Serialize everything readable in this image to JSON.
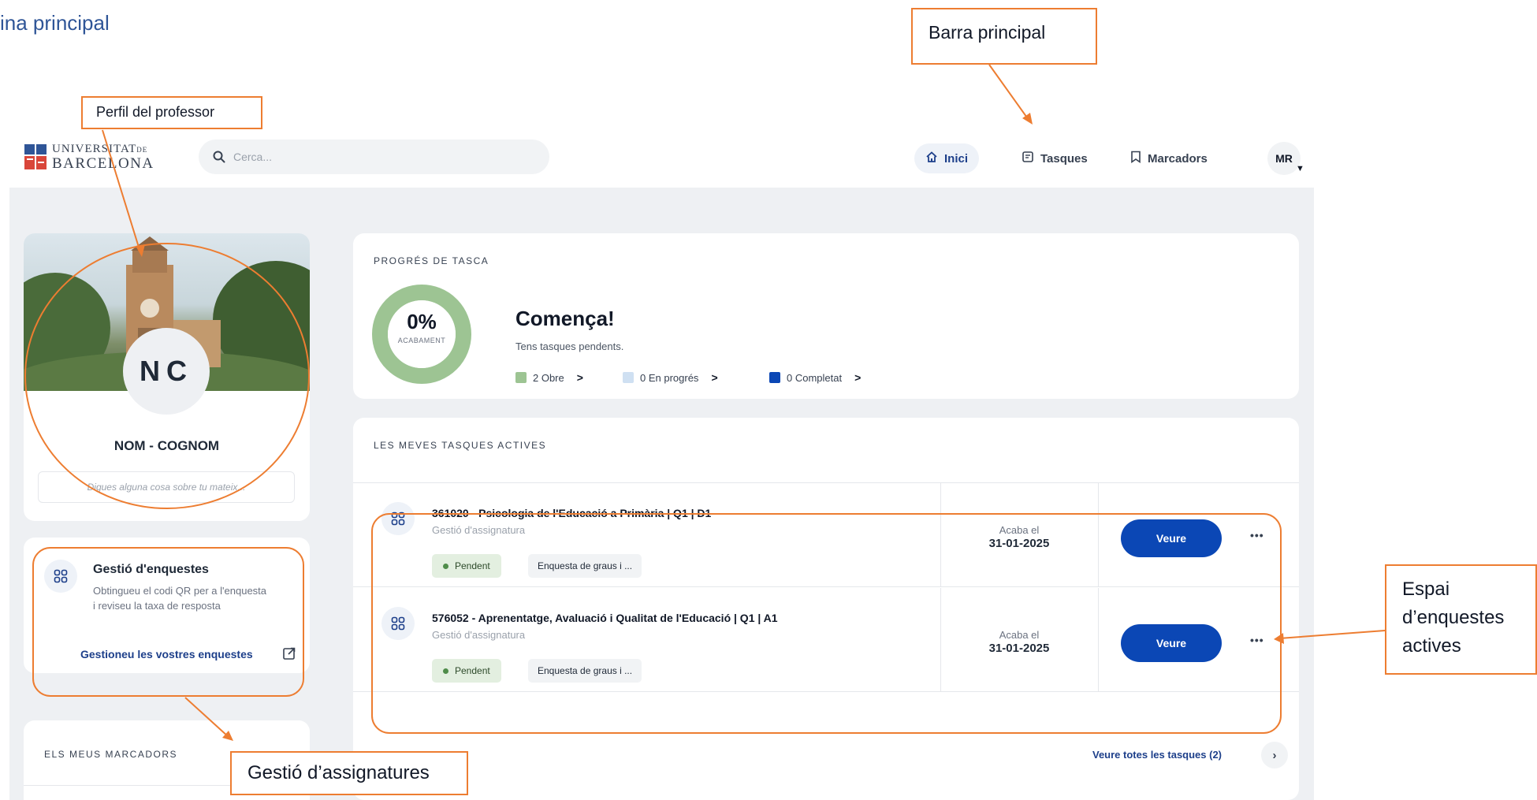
{
  "document": {
    "heading": "ina principal"
  },
  "logo": {
    "line1": "UNIVERSITAT",
    "line1_suffix": "DE",
    "line2": "BARCELONA"
  },
  "search": {
    "placeholder": "Cerca..."
  },
  "nav": {
    "inici": "Inici",
    "tasques": "Tasques",
    "marcadors": "Marcadors",
    "avatar": "MR"
  },
  "profile": {
    "initials": "NC",
    "name": "NOM - COGNOM",
    "bio_placeholder": "Digues alguna cosa sobre tu mateix..."
  },
  "surveys": {
    "title": "Gestió d'enquestes",
    "description": "Obtingueu el codi QR per a l'enquesta i reviseu la taxa de resposta",
    "link": "Gestioneu les vostres enquestes"
  },
  "bookmarks": {
    "title": "ELS MEUS MARCADORS"
  },
  "progress": {
    "label": "PROGRÉS DE TASCA",
    "percent_text": "0%",
    "percent_value": 0,
    "percent_caption": "ACABAMENT",
    "heading": "Comença!",
    "subheading": "Tens tasques pendents.",
    "legend": [
      {
        "text": "2 Obre",
        "color": "#9dc493"
      },
      {
        "text": "0 En progrés",
        "color": "#cfe0f2"
      },
      {
        "text": "0 Completat",
        "color": "#0b47b5"
      }
    ],
    "ring_color": "#9dc493"
  },
  "tasks": {
    "label": "LES MEVES TASQUES ACTIVES",
    "ends_label": "Acaba el",
    "view_label": "Veure",
    "rows": [
      {
        "title": "361020 - Psicologia de l'Educació a Primària | Q1 | D1",
        "subtitle": "Gestió d'assignatura",
        "status": "Pendent",
        "survey": "Enquesta de graus i ...",
        "end_date": "31-01-2025"
      },
      {
        "title": "576052 - Aprenentatge, Avaluació i Qualitat de l'Educació | Q1 | A1",
        "subtitle": "Gestió d'assignatura",
        "status": "Pendent",
        "survey": "Enquesta de graus i ...",
        "end_date": "31-01-2025"
      }
    ],
    "see_all": "Veure totes les tasques (2)"
  },
  "annotations": {
    "profile": "Perfil del professor",
    "topbar": "Barra principal",
    "surveys": "Gestió d’assignatures",
    "active_line1": "Espai",
    "active_line2": "d’enquestes",
    "active_line3": "actives",
    "color": "#ed7d31"
  },
  "colors": {
    "primary": "#0b47b5",
    "accent_link": "#1d3f8a",
    "background": "#eef0f3"
  }
}
